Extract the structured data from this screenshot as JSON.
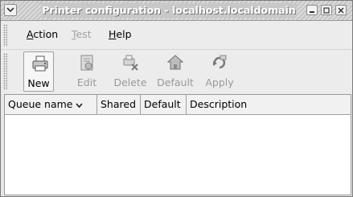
{
  "window": {
    "title": "Printer configuration - localhost.localdomain"
  },
  "menubar": {
    "items": [
      {
        "label": "Action",
        "mnemonic": "A",
        "rest": "ction",
        "enabled": true
      },
      {
        "label": "Test",
        "mnemonic": "T",
        "rest": "est",
        "enabled": false
      },
      {
        "label": "Help",
        "mnemonic": "H",
        "rest": "elp",
        "enabled": true
      }
    ]
  },
  "toolbar": {
    "buttons": [
      {
        "label": "New",
        "icon": "printer-new-icon",
        "enabled": true
      },
      {
        "label": "Edit",
        "icon": "edit-icon",
        "enabled": false
      },
      {
        "label": "Delete",
        "icon": "delete-icon",
        "enabled": false
      },
      {
        "label": "Default",
        "icon": "home-icon",
        "enabled": false
      },
      {
        "label": "Apply",
        "icon": "apply-icon",
        "enabled": false
      }
    ]
  },
  "table": {
    "columns": [
      "Queue name",
      "Shared",
      "Default",
      "Description"
    ],
    "sorted_column": "Queue name",
    "rows": []
  },
  "colors": {
    "titlebar": "#d0d0d0",
    "window_bg": "#ececec",
    "disabled_text": "#9a9a9a"
  }
}
